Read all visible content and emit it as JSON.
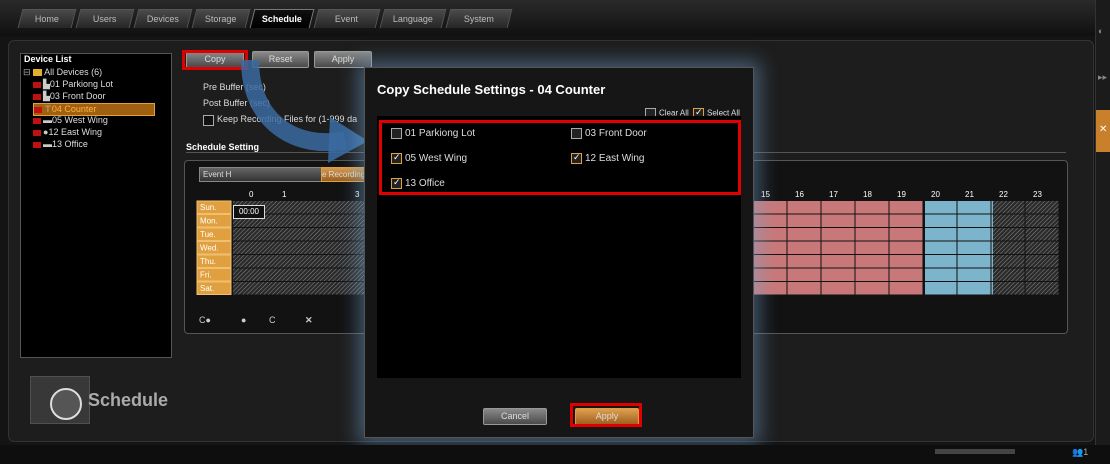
{
  "tabs": [
    "Home",
    "Users",
    "Devices",
    "Storage",
    "Schedule",
    "Event",
    "Language",
    "System"
  ],
  "active_tab": "Schedule",
  "device_list": {
    "header": "Device List",
    "root": "All Devices (6)",
    "items": [
      {
        "label": "01  Parkiong Lot",
        "icon": "camera-icon"
      },
      {
        "label": "03  Front Door",
        "icon": "camera-icon"
      },
      {
        "label": "04  Counter",
        "icon": "camera-icon",
        "selected": true
      },
      {
        "label": "05  West Wing",
        "icon": "camera-icon"
      },
      {
        "label": "12  East Wing",
        "icon": "camera-icon"
      },
      {
        "label": "13  Office",
        "icon": "camera-icon"
      }
    ]
  },
  "toolbar": {
    "copy": "Copy",
    "reset": "Reset",
    "apply": "Apply"
  },
  "form": {
    "pre_buffer": "Pre Buffer (sec)",
    "post_buffer": "Post Buffer (sec)",
    "keep": "Keep Recording Files for (1-999 da",
    "section": "Schedule Setting"
  },
  "grid": {
    "event_header": "Event H",
    "rec_header": "e Recording",
    "hours_left": [
      "0",
      "1",
      "",
      "3"
    ],
    "hours_right": [
      "15",
      "16",
      "17",
      "18",
      "19",
      "20",
      "21",
      "22",
      "23"
    ],
    "days": [
      "Sun.",
      "Mon.",
      "Tue.",
      "Wed.",
      "Thu.",
      "Fri.",
      "Sat."
    ],
    "time_label": "00:00",
    "tools": [
      "C●",
      "●",
      "C",
      "✕"
    ]
  },
  "schedule_logo": "Schedule",
  "dialog": {
    "title": "Copy Schedule Settings - 04 Counter",
    "clear_all": "Clear All",
    "select_all": "Select All",
    "devices": [
      {
        "label": "01 Parkiong Lot",
        "checked": false
      },
      {
        "label": "03 Front Door",
        "checked": false
      },
      {
        "label": "05 West Wing",
        "checked": true
      },
      {
        "label": "12 East Wing",
        "checked": true
      },
      {
        "label": "13 Office",
        "checked": true
      }
    ],
    "cancel": "Cancel",
    "apply": "Apply"
  },
  "colors": {
    "accent": "#e0a040",
    "record": "#c87878",
    "event": "#7cb4cc",
    "highlight": "#e00000"
  }
}
